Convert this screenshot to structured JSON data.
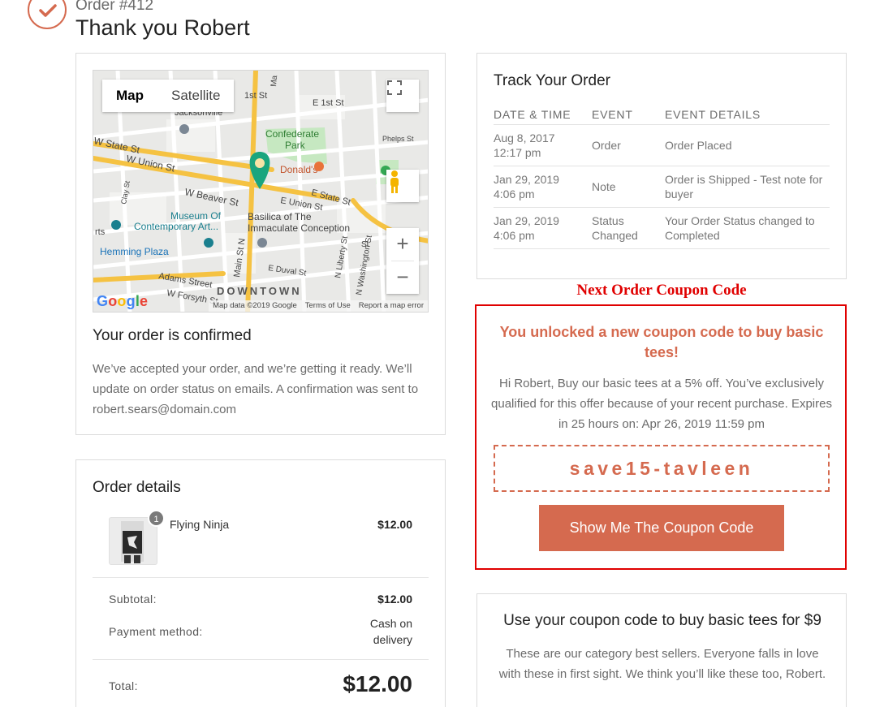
{
  "header": {
    "order_number": "Order #412",
    "title": "Thank you Robert",
    "check_icon": "check-circle-icon"
  },
  "map": {
    "tab_map": "Map",
    "tab_satellite": "Satellite",
    "google_logo": "Google",
    "map_data": "Map data ©2019 Google",
    "terms": "Terms of Use",
    "report": "Report a map error",
    "labels": {
      "jacksonville": "Jacksonville",
      "first_st": "1st St",
      "e_first_st": "E 1st St",
      "phelps": "Phelps St",
      "w_state": "W State St",
      "w_union": "W Union St",
      "confederate": "Confederate",
      "park": "Park",
      "mcdonalds": "Donald's",
      "e_state": "E State St",
      "e_union": "E Union St",
      "w_beaver": "W Beaver St",
      "clay": "Clay St",
      "museum1": "Museum Of",
      "museum2": "Contemporary Art...",
      "basilica1": "Basilica of The",
      "basilica2": "Immaculate Conception",
      "hemming": "Hemming Plaza",
      "adams": "Adams Street",
      "w_forsyth": "W Forsyth St",
      "main_n": "Main St N",
      "n_liberty": "N Liberty St",
      "n_washington": "N Washington St",
      "e_duval": "E Duval St",
      "downtown": "DOWNTOWN",
      "rts": "rts",
      "ma": "Ma",
      "st": "St"
    }
  },
  "confirmation": {
    "title": "Your order is confirmed",
    "text": "We’ve accepted your order, and we’re getting it ready. We’ll update on order status on emails. A confirmation was sent to robert.sears@domain.com"
  },
  "order_details": {
    "title": "Order details",
    "item": {
      "name": "Flying Ninja",
      "price": "$12.00",
      "quantity": "1"
    },
    "subtotal_label": "Subtotal:",
    "subtotal_value": "$12.00",
    "payment_label": "Payment method:",
    "payment_value": "Cash on delivery",
    "total_label": "Total:",
    "total_value": "$12.00"
  },
  "tracking": {
    "title": "Track Your Order",
    "columns": [
      "DATE & TIME",
      "EVENT",
      "EVENT DETAILS"
    ],
    "rows": [
      {
        "date": "Aug 8, 2017",
        "time": "12:17 pm",
        "event": "Order",
        "details": "Order Placed"
      },
      {
        "date": "Jan 29, 2019",
        "time": "4:06 pm",
        "event": "Note",
        "details": "Order is Shipped - Test note for buyer"
      },
      {
        "date": "Jan 29, 2019",
        "time": "4:06 pm",
        "event": "Status Changed",
        "details": "Your Order Status changed to Completed"
      }
    ]
  },
  "coupon": {
    "label": "Next Order Coupon Code",
    "heading": "You unlocked a new coupon code to buy basic tees!",
    "body": "Hi Robert, Buy our basic tees at a 5% off. You’ve exclusively qualified for this offer because of your recent purchase. Expires in 25 hours on: Apr 26, 2019 11:59 pm",
    "code": "save15-tavleen",
    "button": "Show Me The Coupon Code"
  },
  "upsell": {
    "title": "Use your coupon code to buy basic tees for $9",
    "text": "These are our category best sellers. Everyone falls in love with these in first sight. We think you’ll like these too, Robert."
  },
  "colors": {
    "accent": "#d56a4f",
    "coupon_highlight": "#e00000",
    "map_road_major": "#f5c242"
  }
}
